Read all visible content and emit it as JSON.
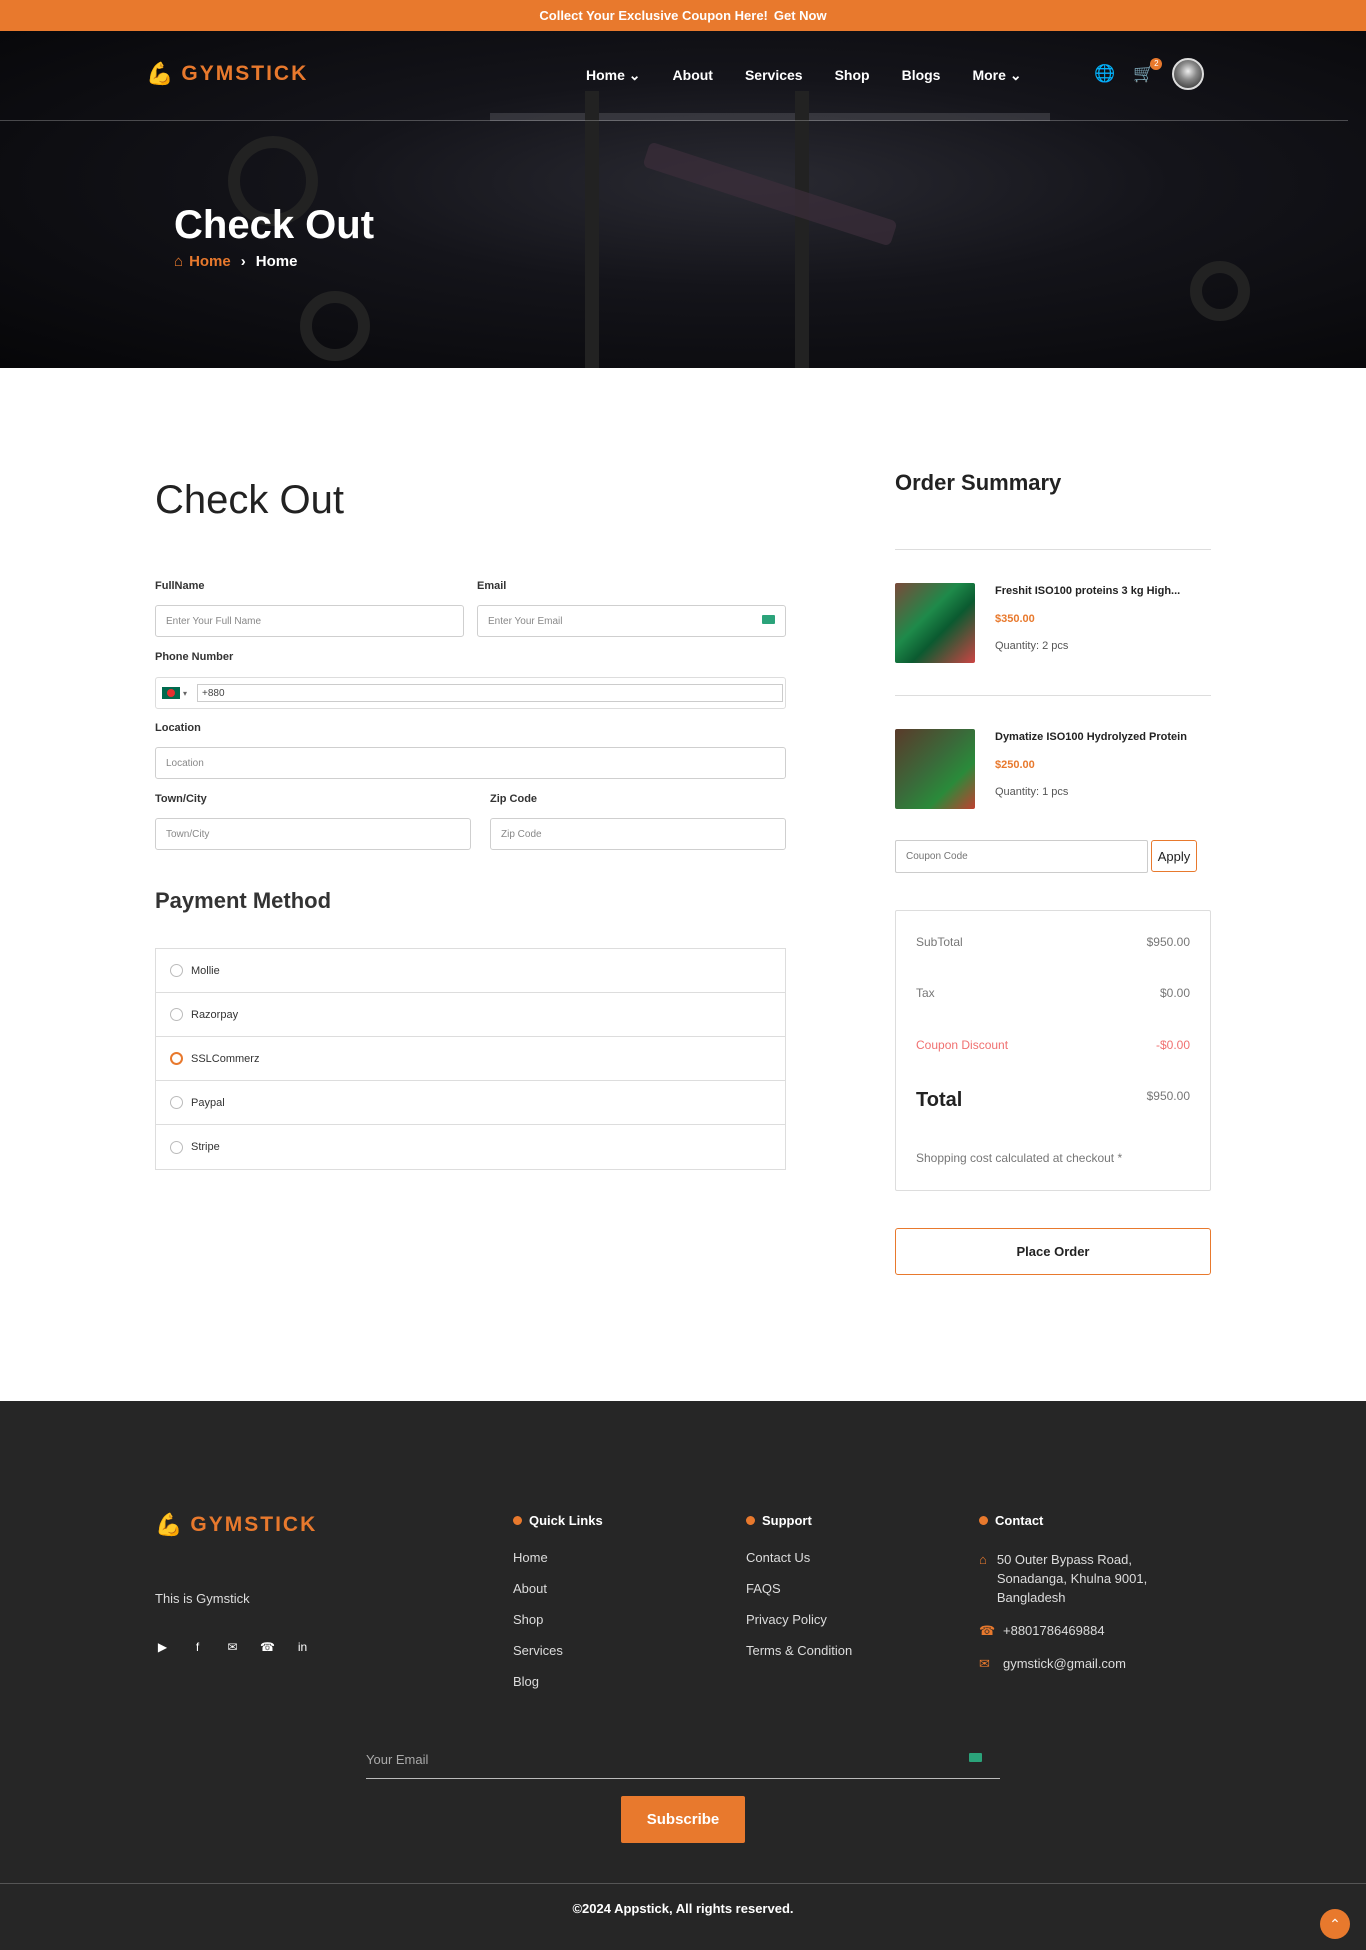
{
  "topbar": {
    "text": "Collect Your Exclusive Coupon Here!",
    "link": "Get Now"
  },
  "brand": {
    "name": "GYMSTICK"
  },
  "nav": {
    "items": [
      {
        "label": "Home",
        "dropdown": true
      },
      {
        "label": "About"
      },
      {
        "label": "Services"
      },
      {
        "label": "Shop"
      },
      {
        "label": "Blogs"
      },
      {
        "label": "More",
        "dropdown": true
      }
    ],
    "cart_count": "2"
  },
  "hero": {
    "title": "Check Out",
    "crumb_home": "Home",
    "crumb_current": "Home"
  },
  "checkout": {
    "title": "Check Out",
    "fullname_label": "FullName",
    "fullname_placeholder": "Enter Your Full Name",
    "email_label": "Email",
    "email_placeholder": "Enter Your Email",
    "phone_label": "Phone Number",
    "phone_value": "+880",
    "location_label": "Location",
    "location_placeholder": "Location",
    "town_label": "Town/City",
    "town_placeholder": "Town/City",
    "zip_label": "Zip Code",
    "zip_placeholder": "Zip Code"
  },
  "payment": {
    "title": "Payment Method",
    "methods": [
      {
        "label": "Mollie",
        "selected": false
      },
      {
        "label": "Razorpay",
        "selected": false
      },
      {
        "label": "SSLCommerz",
        "selected": true
      },
      {
        "label": "Paypal",
        "selected": false
      },
      {
        "label": "Stripe",
        "selected": false
      }
    ]
  },
  "summary": {
    "title": "Order Summary",
    "products": [
      {
        "name": "Freshit ISO100 proteins 3 kg High...",
        "price": "$350.00",
        "qty": "Quantity: 2 pcs"
      },
      {
        "name": "Dymatize ISO100 Hydrolyzed Protein",
        "price": "$250.00",
        "qty": "Quantity: 1 pcs"
      }
    ],
    "coupon_placeholder": "Coupon Code",
    "apply_label": "Apply",
    "subtotal_label": "SubTotal",
    "subtotal": "$950.00",
    "tax_label": "Tax",
    "tax": "$0.00",
    "discount_label": "Coupon Discount",
    "discount": "-$0.00",
    "total_label": "Total",
    "total": "$950.00",
    "ship_note": "Shopping cost calculated at checkout *",
    "place_order": "Place Order"
  },
  "footer": {
    "tagline": "This is Gymstick",
    "quick_title": "Quick Links",
    "quick_links": [
      "Home",
      "About",
      "Shop",
      "Services",
      "Blog"
    ],
    "support_title": "Support",
    "support_links": [
      "Contact Us",
      "FAQS",
      "Privacy Policy",
      "Terms & Condition"
    ],
    "contact_title": "Contact",
    "address": "50 Outer Bypass Road, Sonadanga, Khulna 9001, Bangladesh",
    "phone": "+8801786469884",
    "email": "gymstick@gmail.com",
    "newsletter_placeholder": "Your Email",
    "subscribe": "Subscribe",
    "copyright": "©2024 Appstick, All rights reserved."
  },
  "colors": {
    "accent": "#e8792d",
    "footer_bg": "#262626"
  }
}
